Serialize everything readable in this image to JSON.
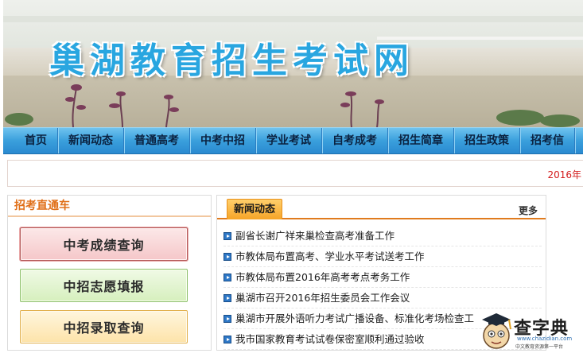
{
  "banner": {
    "title": "巢湖教育招生考试网"
  },
  "nav": {
    "items": [
      {
        "label": "首页"
      },
      {
        "label": "新闻动态"
      },
      {
        "label": "普通高考"
      },
      {
        "label": "中考中招"
      },
      {
        "label": "学业考试"
      },
      {
        "label": "自考成考"
      },
      {
        "label": "招生简章"
      },
      {
        "label": "招生政策"
      },
      {
        "label": "招考信"
      }
    ]
  },
  "notice": {
    "text": "2016年"
  },
  "quick": {
    "title": "招考直通车",
    "buttons": [
      {
        "label": "中考成绩查询"
      },
      {
        "label": "中招志愿填报"
      },
      {
        "label": "中招录取查询"
      }
    ]
  },
  "news": {
    "tab": "新闻动态",
    "more": "更多",
    "items": [
      {
        "title": "副省长谢广祥来巢检查高考准备工作"
      },
      {
        "title": "市教体局布置高考、学业水平考试送考工作"
      },
      {
        "title": "市教体局布置2016年高考考点考务工作"
      },
      {
        "title": "巢湖市召开2016年招生委员会工作会议"
      },
      {
        "title": "巢湖市开展外语听力考试广播设备、标准化考场检查工"
      },
      {
        "title": "我市国家教育考试试卷保密室顺利通过验收"
      }
    ]
  },
  "watermark": {
    "title": "查字典",
    "url": "www.chazidian.com",
    "tagline": "中文教育资源第一平台"
  }
}
